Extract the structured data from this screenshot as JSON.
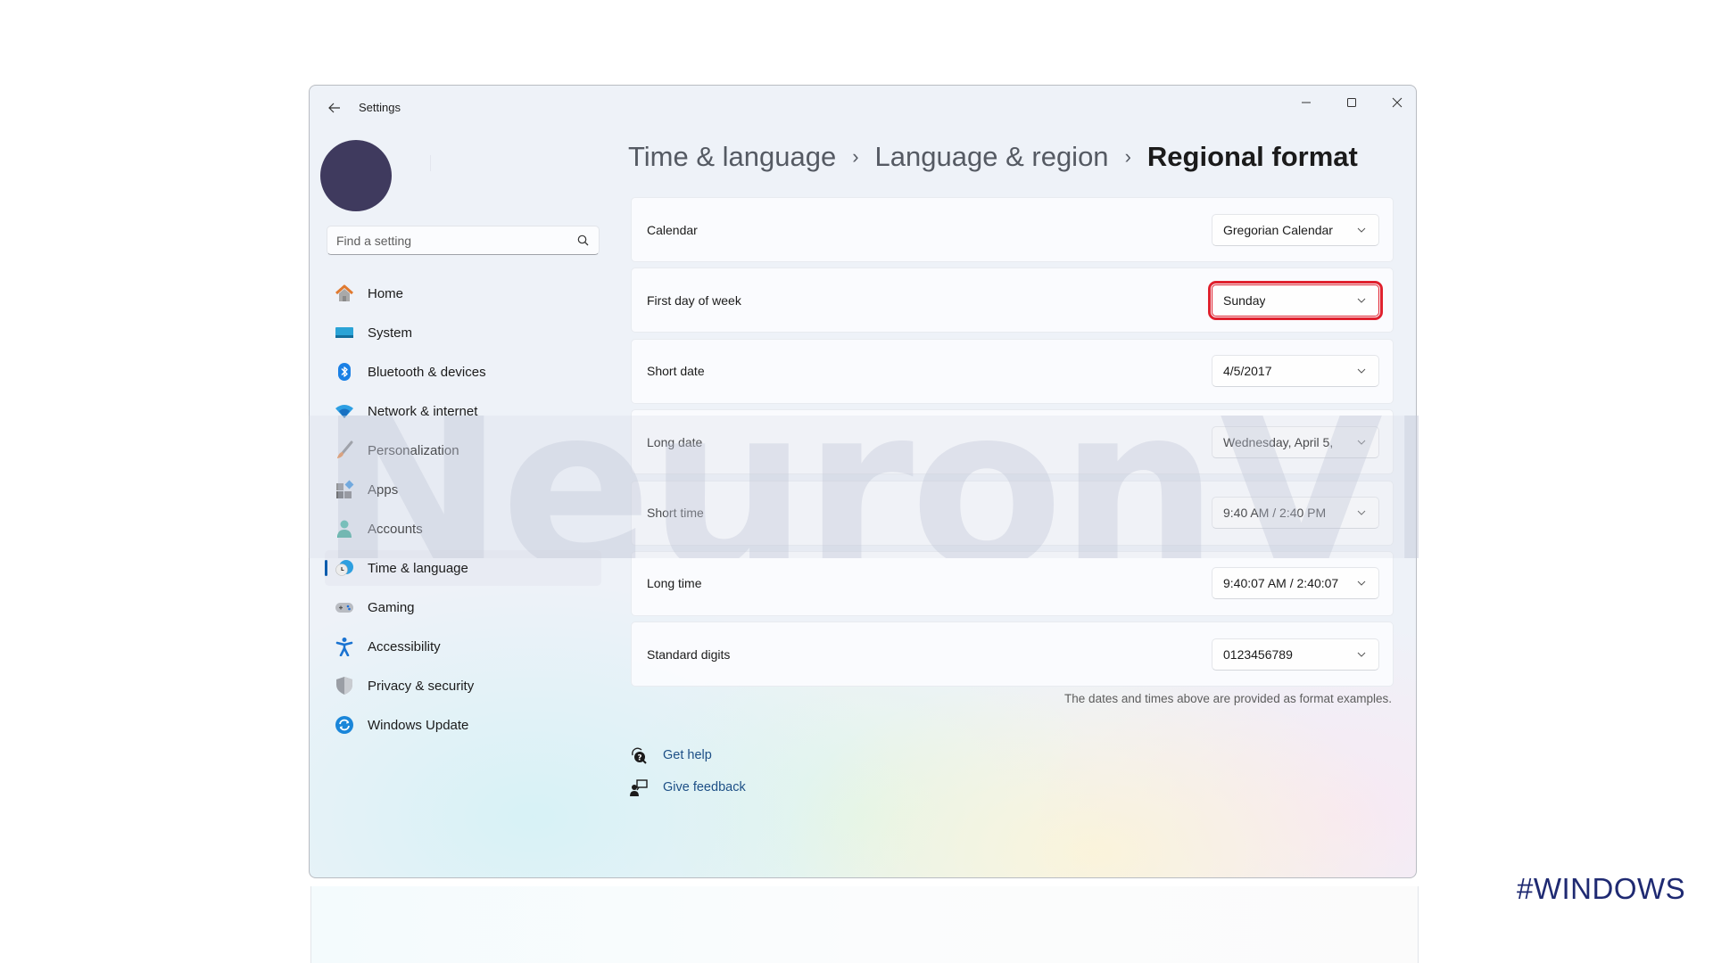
{
  "window": {
    "title": "Settings",
    "controls": {
      "minimize": "minimize-icon",
      "maximize": "maximize-icon",
      "close": "close-icon"
    }
  },
  "sidebar": {
    "search_placeholder": "Find a setting",
    "items": [
      {
        "label": "Home",
        "icon": "home-icon",
        "active": false
      },
      {
        "label": "System",
        "icon": "system-icon",
        "active": false
      },
      {
        "label": "Bluetooth & devices",
        "icon": "bluetooth-icon",
        "active": false
      },
      {
        "label": "Network & internet",
        "icon": "wifi-icon",
        "active": false
      },
      {
        "label": "Personalization",
        "icon": "brush-icon",
        "active": false
      },
      {
        "label": "Apps",
        "icon": "apps-icon",
        "active": false
      },
      {
        "label": "Accounts",
        "icon": "accounts-icon",
        "active": false
      },
      {
        "label": "Time & language",
        "icon": "time-language-icon",
        "active": true
      },
      {
        "label": "Gaming",
        "icon": "gamepad-icon",
        "active": false
      },
      {
        "label": "Accessibility",
        "icon": "accessibility-icon",
        "active": false
      },
      {
        "label": "Privacy & security",
        "icon": "shield-icon",
        "active": false
      },
      {
        "label": "Windows Update",
        "icon": "update-icon",
        "active": false
      }
    ]
  },
  "breadcrumb": {
    "items": [
      "Time & language",
      "Language & region",
      "Regional format"
    ]
  },
  "settings": [
    {
      "label": "Calendar",
      "value": "Gregorian Calendar",
      "highlighted": false
    },
    {
      "label": "First day of week",
      "value": "Sunday",
      "highlighted": true
    },
    {
      "label": "Short date",
      "value": "4/5/2017",
      "highlighted": false
    },
    {
      "label": "Long date",
      "value": "Wednesday, April 5,",
      "highlighted": false
    },
    {
      "label": "Short time",
      "value": "9:40 AM / 2:40 PM",
      "highlighted": false
    },
    {
      "label": "Long time",
      "value": "9:40:07 AM / 2:40:07",
      "highlighted": false
    },
    {
      "label": "Standard digits",
      "value": "0123456789",
      "highlighted": false
    }
  ],
  "note": "The dates and times above are provided as format examples.",
  "links": [
    {
      "label": "Get help",
      "icon": "help-icon"
    },
    {
      "label": "Give feedback",
      "icon": "feedback-icon"
    }
  ],
  "watermark": "NeuronVM",
  "tag": "#WINDOWS",
  "colors": {
    "highlight_outline": "#e0212e",
    "link": "#1d4f86",
    "accent": "#0b5cad",
    "avatar": "#3f3a5e",
    "tag": "#1f2a72"
  }
}
